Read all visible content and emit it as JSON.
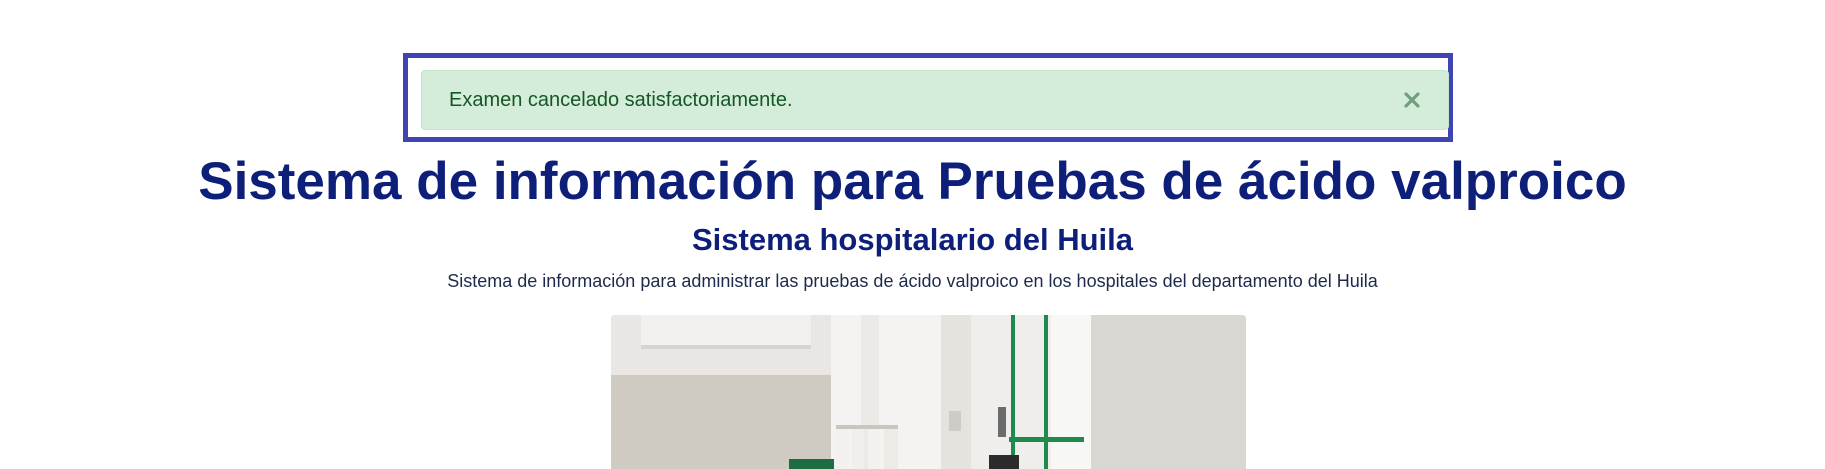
{
  "alert": {
    "message": "Examen cancelado satisfactoriamente.",
    "close_icon": "close-icon",
    "colors": {
      "background": "#d4edda",
      "text": "#155724",
      "frame": "#3f44b5"
    }
  },
  "header": {
    "title": "Sistema de información para Pruebas de ácido valproico",
    "subtitle": "Sistema hospitalario del Huila",
    "description": "Sistema de información para administrar las pruebas de ácido valproico en los hospitales del departamento del Huila",
    "title_color": "#0e1f7a"
  }
}
